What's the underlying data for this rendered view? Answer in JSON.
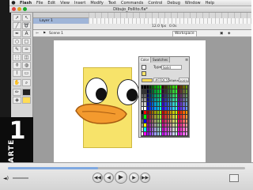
{
  "menubar": {
    "apple": "",
    "items": [
      "Flash",
      "File",
      "Edit",
      "View",
      "Insert",
      "Modify",
      "Text",
      "Commands",
      "Control",
      "Debug",
      "Window",
      "Help"
    ]
  },
  "document": {
    "title": "Dibujo_Pollito.fla*"
  },
  "timeline": {
    "layer_name": "Layer 1",
    "status_fps": "12.0 fps",
    "status_time": "0.0s"
  },
  "editbar": {
    "scene_label": "Scene 1",
    "zoom_label": "Workspace"
  },
  "color_panel": {
    "tabs": [
      "Color",
      "Swatches"
    ],
    "type_label": "Type:",
    "type_value": "Solid",
    "hex_value": "#FFDC55",
    "alpha_label": "Alpha:",
    "alpha_value": "100%",
    "selected_fill": "#FFDC55"
  },
  "overlay": {
    "part_number": "1",
    "part_word": "PARTE"
  },
  "player": {
    "progress": 0.38
  },
  "colors": {
    "duck_body": "#F7E36A",
    "beak": "#F39A2E",
    "stage": "#9C9C9C",
    "panel": "#DCDCDC"
  }
}
